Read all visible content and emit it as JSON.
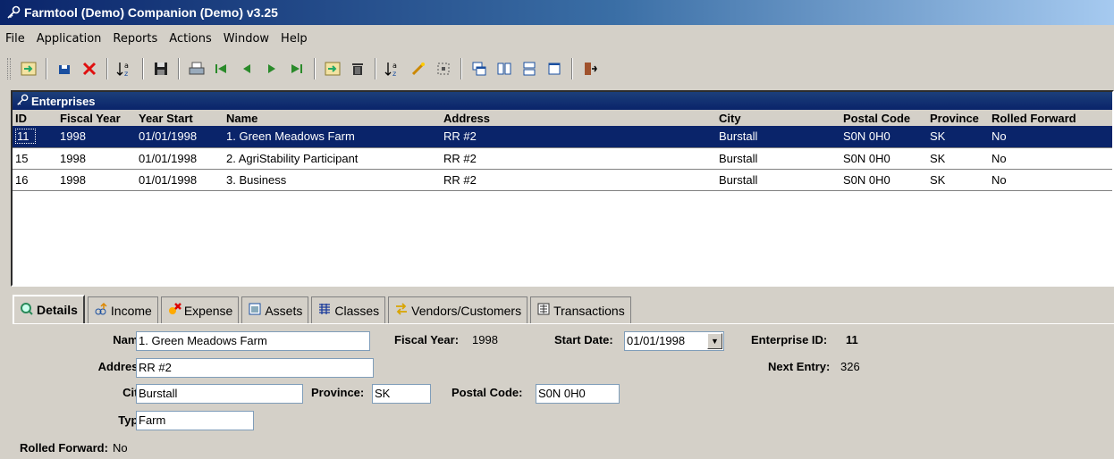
{
  "window": {
    "title": "Farmtool (Demo) Companion (Demo) v3.25"
  },
  "menu": [
    "File",
    "Application",
    "Reports",
    "Actions",
    "Window",
    "Help"
  ],
  "toolbar": {
    "icons": [
      "import-icon",
      "save-icon",
      "delete-icon",
      "sort-icon",
      "disk-icon",
      "print-icon",
      "first-record-icon",
      "prev-record-icon",
      "next-record-icon",
      "last-record-icon",
      "export-icon",
      "trash-icon",
      "sort-az-icon",
      "wand-icon",
      "select-icon",
      "cascade-icon",
      "tile-vertical-icon",
      "tile-horizontal-icon",
      "window-icon",
      "exit-icon"
    ]
  },
  "enterprises": {
    "title": "Enterprises",
    "columns": [
      "ID",
      "Fiscal Year",
      "Year Start",
      "Name",
      "Address",
      "City",
      "Postal Code",
      "Province",
      "Rolled Forward"
    ],
    "rows": [
      [
        "11",
        "1998",
        "01/01/1998",
        "1. Green Meadows Farm",
        "RR #2",
        "Burstall",
        "S0N 0H0",
        "SK",
        "No"
      ],
      [
        "15",
        "1998",
        "01/01/1998",
        "2. AgriStability Participant",
        "RR #2",
        "Burstall",
        "S0N 0H0",
        "SK",
        "No"
      ],
      [
        "16",
        "1998",
        "01/01/1998",
        "3. Business",
        "RR #2",
        "Burstall",
        "S0N 0H0",
        "SK",
        "No"
      ]
    ]
  },
  "tabs": [
    "Details",
    "Income",
    "Expense",
    "Assets",
    "Classes",
    "Vendors/Customers",
    "Transactions"
  ],
  "details": {
    "name_label": "Name:",
    "name_value": "1. Green Meadows Farm",
    "fiscal_year_label": "Fiscal Year:",
    "fiscal_year_value": "1998",
    "start_date_label": "Start Date:",
    "start_date_value": "01/01/1998",
    "enterprise_id_label": "Enterprise ID:",
    "enterprise_id_value": "11",
    "address_label": "Address:",
    "address_value": "RR #2",
    "next_entry_label": "Next Entry:",
    "next_entry_value": "326",
    "city_label": "City:",
    "city_value": "Burstall",
    "province_label": "Province:",
    "province_value": "SK",
    "postal_code_label": "Postal Code:",
    "postal_code_value": "S0N 0H0",
    "type_label": "Type:",
    "type_value": "Farm",
    "rolled_forward_label": "Rolled Forward:",
    "rolled_forward_value": "No"
  }
}
